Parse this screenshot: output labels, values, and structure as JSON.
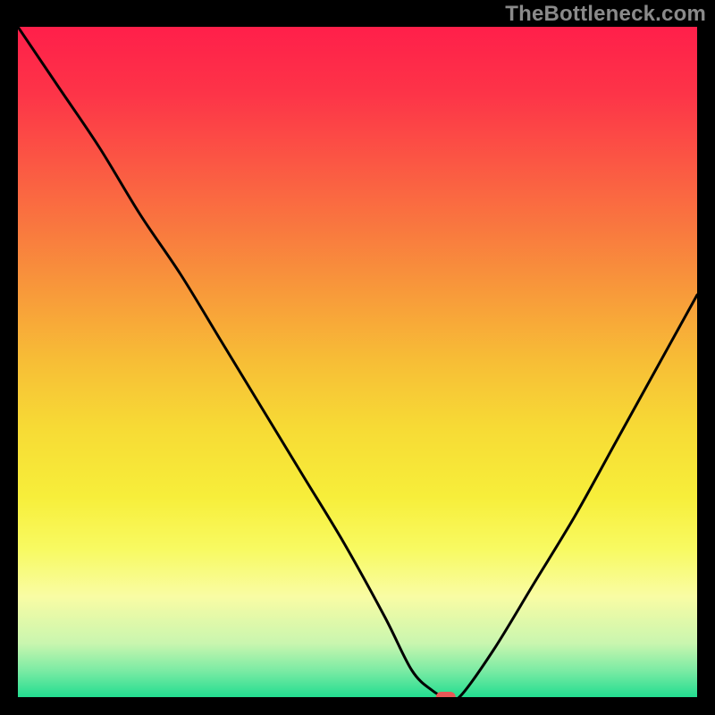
{
  "watermark": "TheBottleneck.com",
  "chart_data": {
    "type": "line",
    "title": "",
    "xlabel": "",
    "ylabel": "",
    "xlim": [
      0,
      100
    ],
    "ylim": [
      0,
      100
    ],
    "grid": false,
    "legend": false,
    "series": [
      {
        "name": "bottleneck-curve",
        "x": [
          0,
          6,
          12,
          18,
          24,
          30,
          36,
          42,
          48,
          54,
          58,
          61,
          63,
          65,
          70,
          76,
          82,
          88,
          94,
          100
        ],
        "y": [
          100,
          91,
          82,
          72,
          63,
          53,
          43,
          33,
          23,
          12,
          4,
          1,
          0,
          0,
          7,
          17,
          27,
          38,
          49,
          60
        ]
      }
    ],
    "marker": {
      "name": "optimal-point",
      "x": 63,
      "y": 0,
      "color": "#E95757"
    },
    "background_gradient": {
      "stops": [
        {
          "offset": 0.0,
          "color": "#FF1F4A"
        },
        {
          "offset": 0.1,
          "color": "#FD3448"
        },
        {
          "offset": 0.2,
          "color": "#FB5644"
        },
        {
          "offset": 0.3,
          "color": "#F9783F"
        },
        {
          "offset": 0.4,
          "color": "#F89B3A"
        },
        {
          "offset": 0.5,
          "color": "#F7BE36"
        },
        {
          "offset": 0.6,
          "color": "#F7DB35"
        },
        {
          "offset": 0.7,
          "color": "#F7EE3A"
        },
        {
          "offset": 0.78,
          "color": "#F8FA62"
        },
        {
          "offset": 0.85,
          "color": "#F9FCA4"
        },
        {
          "offset": 0.92,
          "color": "#C9F6AF"
        },
        {
          "offset": 0.96,
          "color": "#7CEBA4"
        },
        {
          "offset": 1.0,
          "color": "#22DD90"
        }
      ]
    }
  }
}
